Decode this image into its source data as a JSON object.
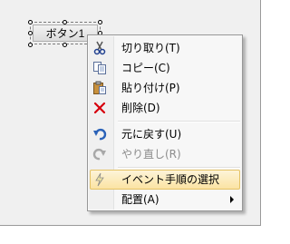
{
  "form": {
    "button_text": "ボタン1"
  },
  "context_menu": {
    "items": [
      {
        "label": "切り取り(T)",
        "icon": "scissors-icon",
        "enabled": true
      },
      {
        "label": "コピー(C)",
        "icon": "copy-icon",
        "enabled": true
      },
      {
        "label": "貼り付け(P)",
        "icon": "paste-icon",
        "enabled": true
      },
      {
        "label": "削除(D)",
        "icon": "delete-icon",
        "enabled": true
      },
      {
        "label": "元に戻す(U)",
        "icon": "undo-icon",
        "enabled": true
      },
      {
        "label": "やり直し(R)",
        "icon": "redo-icon",
        "enabled": false
      },
      {
        "label": "イベント手順の選択",
        "icon": "lightning-icon",
        "enabled": true,
        "highlighted": true
      },
      {
        "label": "配置(A)",
        "icon": "",
        "enabled": true,
        "has_submenu": true
      }
    ]
  },
  "colors": {
    "highlight_fill": "#fbe3a3",
    "highlight_border": "#e5c365",
    "delete_red": "#d6000c",
    "undo_blue": "#2a62b8",
    "menu_background": "#f7f7f7"
  }
}
